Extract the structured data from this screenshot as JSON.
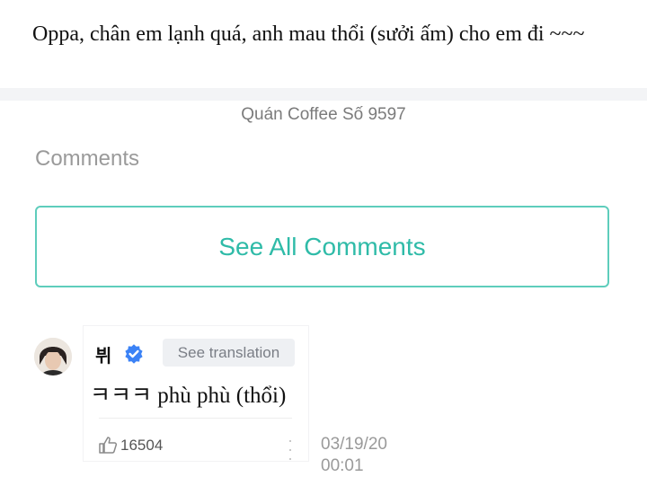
{
  "post": {
    "text": "Oppa, chân em lạnh quá, anh mau thổi (sưởi ấm) cho em đi ~~~",
    "location": "Quán Coffee Số 9597"
  },
  "comments_section": {
    "heading": "Comments",
    "see_all_label": "See All Comments"
  },
  "comment": {
    "author": "뷔",
    "translate_label": "See translation",
    "body": "ㅋㅋㅋ phù phù (thổi)",
    "likes": "16504",
    "date": "03/19/20",
    "time": "00:01"
  },
  "colors": {
    "accent": "#2fbba8",
    "verified": "#3b82f6"
  },
  "icons": [
    "verified-badge-icon",
    "like-icon",
    "more-options-icon",
    "avatar"
  ]
}
